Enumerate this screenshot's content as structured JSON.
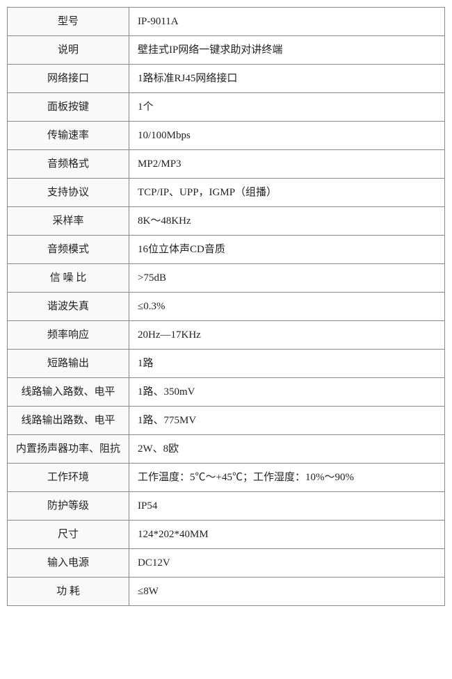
{
  "table": {
    "rows": [
      {
        "label": "型号",
        "value": "IP-9011A",
        "label_class": ""
      },
      {
        "label": "说明",
        "value": "壁挂式IP网络一键求助对讲终端",
        "label_class": ""
      },
      {
        "label": "网络接口",
        "value": "1路标准RJ45网络接口",
        "label_class": ""
      },
      {
        "label": "面板按键",
        "value": "1个",
        "label_class": ""
      },
      {
        "label": "传输速率",
        "value": "10/100Mbps",
        "label_class": ""
      },
      {
        "label": "音频格式",
        "value": "MP2/MP3",
        "label_class": ""
      },
      {
        "label": "支持协议",
        "value": "TCP/IP、UPP，IGMP（组播）",
        "label_class": ""
      },
      {
        "label": "采样率",
        "value": "8K～48KHz",
        "label_class": ""
      },
      {
        "label": "音频模式",
        "value": "16位立体声CD音质",
        "label_class": ""
      },
      {
        "label": "信  噪  比",
        "value": ">75dB",
        "label_class": "label-spaced"
      },
      {
        "label": "谐波失真",
        "value": "≤0.3%",
        "label_class": ""
      },
      {
        "label": "频率响应",
        "value": "20Hz—17KHz",
        "label_class": ""
      },
      {
        "label": "短路输出",
        "value": "1路",
        "label_class": ""
      },
      {
        "label": "线路输入路数、电平",
        "value": "1路、350mV",
        "label_class": ""
      },
      {
        "label": "线路输出路数、电平",
        "value": "1路、775MV",
        "label_class": ""
      },
      {
        "label": "内置扬声器功率、阻抗",
        "value": "2W、8欧",
        "label_class": ""
      },
      {
        "label": "工作环境",
        "value": "工作温度：5℃～+45℃；工作湿度：10%～90%",
        "label_class": ""
      },
      {
        "label": "防护等级",
        "value": "IP54",
        "label_class": ""
      },
      {
        "label": "尺寸",
        "value": "124*202*40MM",
        "label_class": ""
      },
      {
        "label": "输入电源",
        "value": "DC12V",
        "label_class": ""
      },
      {
        "label": "功    耗",
        "value": "≤8W",
        "label_class": "label-spaced"
      }
    ]
  }
}
